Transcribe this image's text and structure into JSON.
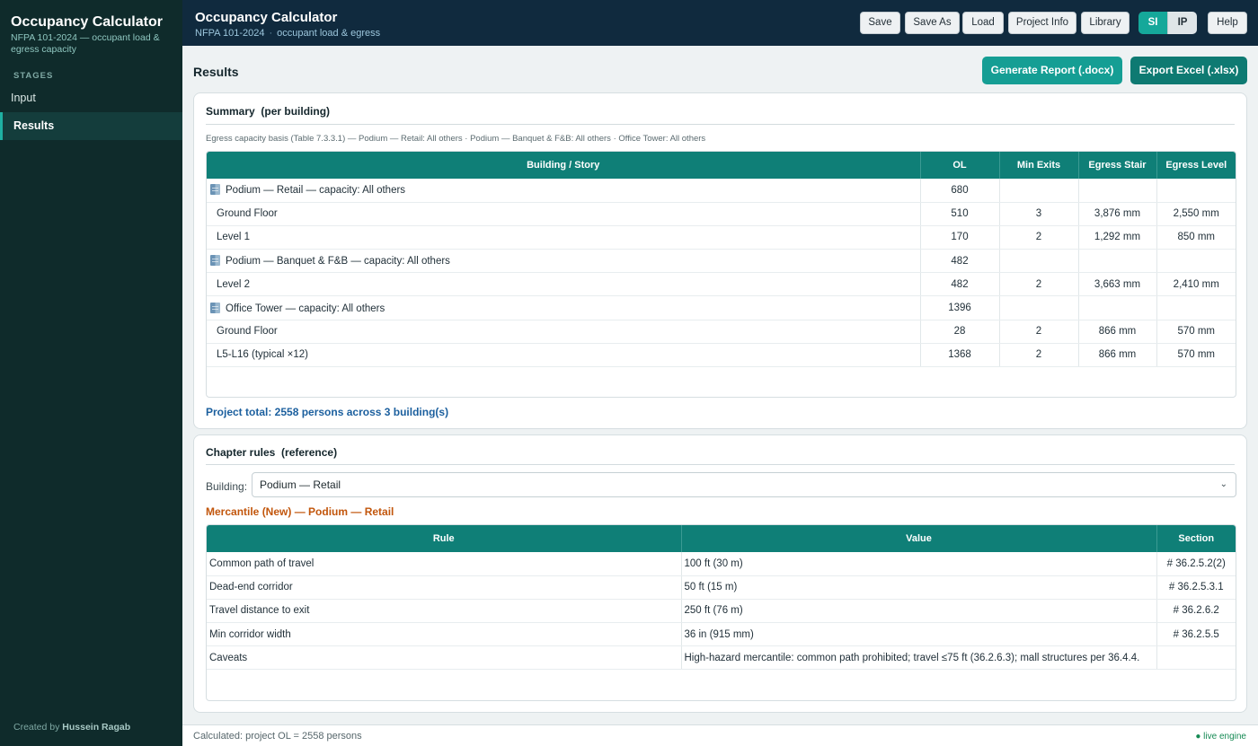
{
  "sidebar": {
    "title": "Occupancy Calculator",
    "subtitle": "NFPA 101-2024 — occupant load & egress capacity",
    "stages_label": "STAGES",
    "items": [
      {
        "label": "Input",
        "active": false
      },
      {
        "label": "Results",
        "active": true
      }
    ],
    "credit_prefix": "Created by",
    "credit_name": "Hussein Ragab"
  },
  "topbar": {
    "title": "Occupancy Calculator",
    "subtitle_a": "NFPA 101-2024",
    "subtitle_b": "occupant load & egress",
    "buttons": [
      "Save",
      "Save As",
      "Load",
      "Project Info",
      "Library"
    ],
    "units": {
      "si": "SI",
      "ip": "IP",
      "selected": "SI"
    },
    "help": "Help"
  },
  "results": {
    "title": "Results",
    "report_btn": "Generate Report (.docx)",
    "excel_btn": "Export Excel (.xlsx)"
  },
  "summary": {
    "heading": "Summary",
    "heading_hint": "(per building)",
    "basis": "Egress capacity basis (Table 7.3.3.1) — Podium — Retail: All others · Podium — Banquet & F&B: All others · Office Tower: All others",
    "columns": [
      "Building / Story",
      "OL",
      "Min Exits",
      "Egress Stair",
      "Egress Level"
    ],
    "rows": [
      {
        "type": "building",
        "name": "Podium — Retail — capacity: All others",
        "ol": "680",
        "exits": "",
        "stair": "",
        "level": ""
      },
      {
        "type": "story",
        "name": "Ground Floor",
        "ol": "510",
        "exits": "3",
        "stair": "3,876 mm",
        "level": "2,550 mm"
      },
      {
        "type": "story",
        "name": "Level 1",
        "ol": "170",
        "exits": "2",
        "stair": "1,292 mm",
        "level": "850 mm"
      },
      {
        "type": "building",
        "name": "Podium — Banquet & F&B — capacity: All others",
        "ol": "482",
        "exits": "",
        "stair": "",
        "level": ""
      },
      {
        "type": "story",
        "name": "Level 2",
        "ol": "482",
        "exits": "2",
        "stair": "3,663 mm",
        "level": "2,410 mm"
      },
      {
        "type": "building",
        "name": "Office Tower — capacity: All others",
        "ol": "1396",
        "exits": "",
        "stair": "",
        "level": ""
      },
      {
        "type": "story",
        "name": "Ground Floor",
        "ol": "28",
        "exits": "2",
        "stair": "866 mm",
        "level": "570 mm"
      },
      {
        "type": "story",
        "name": "L5-L16 (typical ×12)",
        "ol": "1368",
        "exits": "2",
        "stair": "866 mm",
        "level": "570 mm"
      }
    ],
    "total": "Project total: 2558 persons across 3 building(s)"
  },
  "chapter": {
    "heading": "Chapter rules",
    "heading_hint": "(reference)",
    "building_label": "Building:",
    "building_selected": "Podium — Retail",
    "occupancy_title": "Mercantile (New)  —  Podium — Retail",
    "columns": [
      "Rule",
      "Value",
      "Section"
    ],
    "rows": [
      {
        "rule": "Common path of travel",
        "value": "100 ft (30 m)",
        "section": "# 36.2.5.2(2)"
      },
      {
        "rule": "Dead-end corridor",
        "value": "50 ft (15 m)",
        "section": "# 36.2.5.3.1"
      },
      {
        "rule": "Travel distance to exit",
        "value": "250 ft (76 m)",
        "section": "# 36.2.6.2"
      },
      {
        "rule": "Min corridor width",
        "value": "36 in (915 mm)",
        "section": "# 36.2.5.5"
      },
      {
        "rule": "Caveats",
        "value": "High-hazard mercantile: common path prohibited; travel ≤75 ft (36.2.6.3); mall structures per 36.4.4.",
        "section": ""
      }
    ]
  },
  "status": {
    "calc": "Calculated: project OL = 2558 persons",
    "live": "● live engine"
  },
  "colors": {
    "sidebar": "#0f2b2b",
    "topbar": "#102a3e",
    "teal": "#0f7f77",
    "accent": "#15a89a",
    "total_text": "#1b5f9e",
    "occupancy_text": "#c2560c"
  }
}
